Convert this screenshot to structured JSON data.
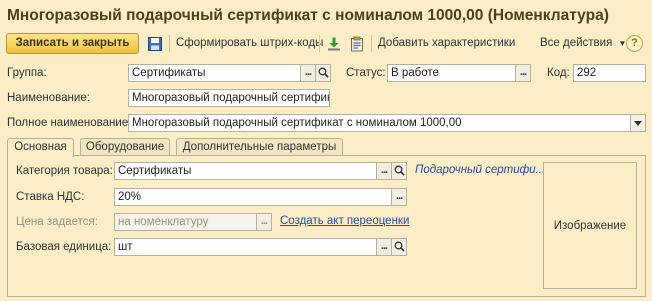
{
  "window": {
    "title": "Многоразовый подарочный сертификат с номиналом 1000,00 (Номенклатура)"
  },
  "toolbar": {
    "save_close_label": "Записать и закрыть",
    "barcode_label": "Сформировать штрих-коды",
    "add_characteristics_label": "Добавить характеристики",
    "all_actions_label": "Все действия",
    "help_label": "?"
  },
  "header": {
    "group_label": "Группа:",
    "group_value": "Сертификаты",
    "status_label": "Статус:",
    "status_value": "В работе",
    "code_label": "Код:",
    "code_value": "292",
    "name_label": "Наименование:",
    "name_value": "Многоразовый подарочный сертификат",
    "full_name_label": "Полное наименование:",
    "full_name_value": "Многоразовый подарочный сертификат с номиналом 1000,00"
  },
  "tabs": [
    {
      "label": "Основная"
    },
    {
      "label": "Оборудование"
    },
    {
      "label": "Дополнительные параметры"
    }
  ],
  "main": {
    "category_label": "Категория товара:",
    "category_value": "Сертификаты",
    "category_link": "Подарочный сертифи...",
    "vat_label": "Ставка НДС:",
    "vat_value": "20%",
    "price_label": "Цена задается:",
    "price_value": "на номенклатуру",
    "revaluation_link": "Создать акт переоценки",
    "unit_label": "Базовая единица:",
    "unit_value": "шт",
    "image_label": "Изображение"
  },
  "colors": {
    "background": "#fbeec7",
    "title": "#4e4115",
    "primary_button": "#f2c239",
    "link": "#274d9e"
  }
}
